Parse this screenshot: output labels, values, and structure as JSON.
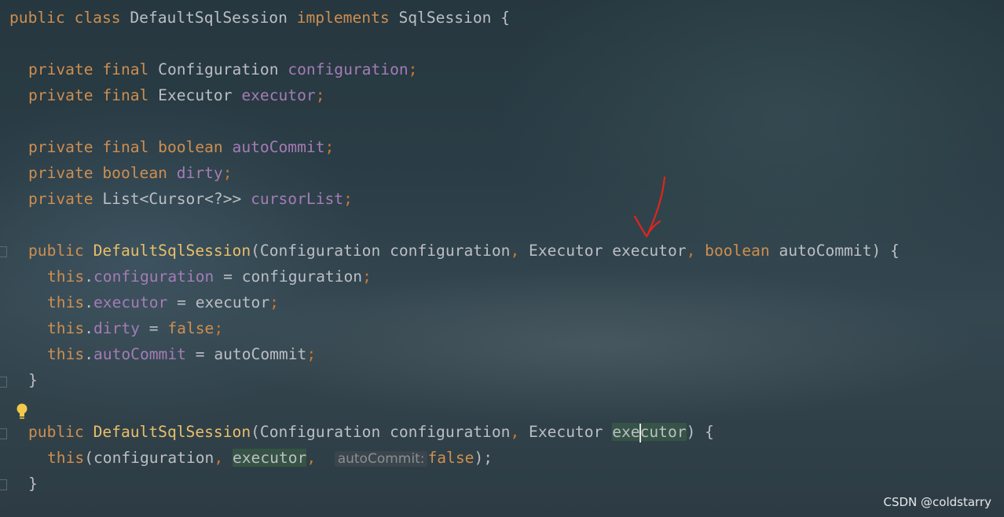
{
  "code": {
    "class_decl": {
      "kw_public": "public",
      "kw_class": "class",
      "name": "DefaultSqlSession",
      "kw_implements": "implements",
      "iface": "SqlSession",
      "brace": "{"
    },
    "fields": [
      {
        "mods": "private final",
        "type": "Configuration",
        "name": "configuration"
      },
      {
        "mods": "private final",
        "type": "Executor",
        "name": "executor"
      },
      {
        "mods": "private final",
        "type": "boolean",
        "name": "autoCommit"
      },
      {
        "mods": "private",
        "type": "boolean",
        "name": "dirty"
      },
      {
        "mods": "private",
        "type": "List<Cursor<?>>",
        "name": "cursorList"
      }
    ],
    "ctor1": {
      "kw": "public",
      "name": "DefaultSqlSession",
      "sig_open": "(Configuration configuration",
      "sig_mid": "Executor executor",
      "kw_boolean": "boolean",
      "sig_end": "autoCommit) {",
      "body": [
        {
          "this": "this",
          "field": "configuration",
          "rhs": "configuration"
        },
        {
          "this": "this",
          "field": "executor",
          "rhs": "executor"
        },
        {
          "this": "this",
          "field": "dirty",
          "rhs": "false"
        },
        {
          "this": "this",
          "field": "autoCommit",
          "rhs": "autoCommit"
        }
      ],
      "close": "}"
    },
    "ctor2": {
      "kw": "public",
      "name": "DefaultSqlSession",
      "sig_open": "(Configuration configuration",
      "type_exec": "Executor",
      "param_a": "exe",
      "param_b": "cutor",
      "sig_end": ") {",
      "call_this": "this",
      "arg1": "(configuration",
      "arg2": "executor",
      "hint": "autoCommit:",
      "arg3": "false",
      "call_end": ");",
      "close": "}"
    }
  },
  "colors": {
    "annotation_arrow": "#e0251c"
  },
  "watermark": "CSDN @coldstarry"
}
